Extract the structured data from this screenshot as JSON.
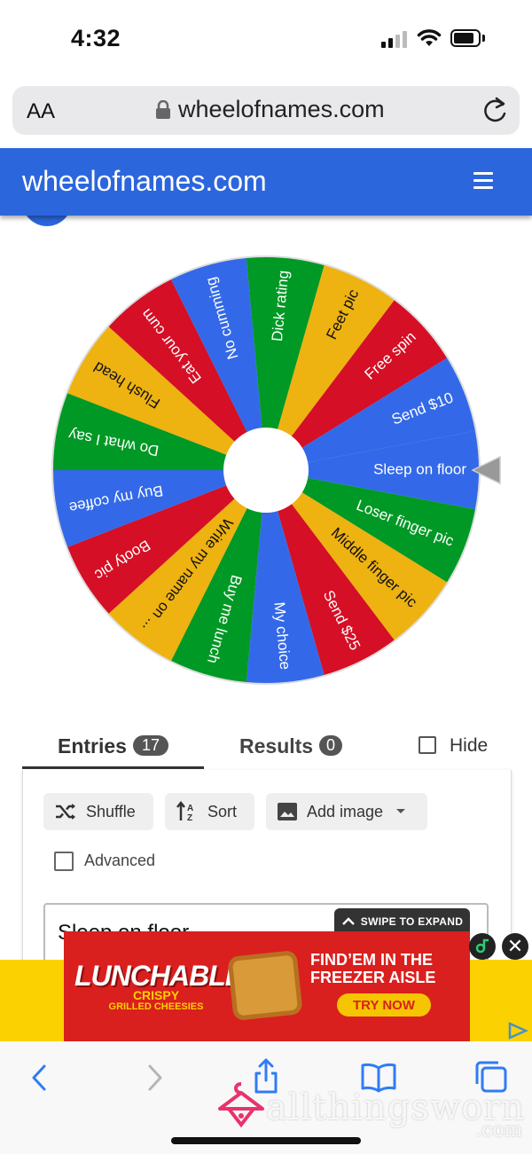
{
  "status_bar": {
    "time": "4:32"
  },
  "browser": {
    "text_size_label": "AA",
    "url": "wheelofnames.com"
  },
  "site": {
    "title": "wheelofnames.com",
    "brand_color": "#2c66dc"
  },
  "wheel": {
    "colors": [
      "#3369e8",
      "#009925",
      "#eeb211",
      "#d50f25"
    ],
    "pointer_segment": "Sleep on floor",
    "entries": [
      "Sleep on floor",
      "Loser finger pic",
      "Middle finger pic",
      "Send $25",
      "My choice",
      "Buy me lunch",
      "Write my name on ...",
      "Booty pic",
      "Buy my coffee",
      "Do what I say",
      "Flush head",
      "Eat your cum",
      "No cumming",
      "Dick rating",
      "Feet pic",
      "Free spin",
      "Send $10"
    ]
  },
  "tabs": {
    "entries_label": "Entries",
    "entries_count": "17",
    "results_label": "Results",
    "results_count": "0",
    "hide_label": "Hide"
  },
  "toolbar": {
    "shuffle_label": "Shuffle",
    "sort_label": "Sort",
    "add_image_label": "Add image",
    "advanced_label": "Advanced"
  },
  "entries_textarea": {
    "first_line": "Sleep on floor"
  },
  "ad": {
    "swipe_label": "SWIPE TO EXPAND",
    "brand": "LUNCHABLES",
    "sub_line1": "CRISPY",
    "sub_line2": "GRILLED CHEESIES",
    "headline_line1": "FIND’EM IN THE",
    "headline_line2": "FREEZER AISLE",
    "cta": "TRY NOW",
    "close_symbol": "✕"
  },
  "watermark": {
    "text": "allthingsworn",
    "suffix": ".com"
  }
}
